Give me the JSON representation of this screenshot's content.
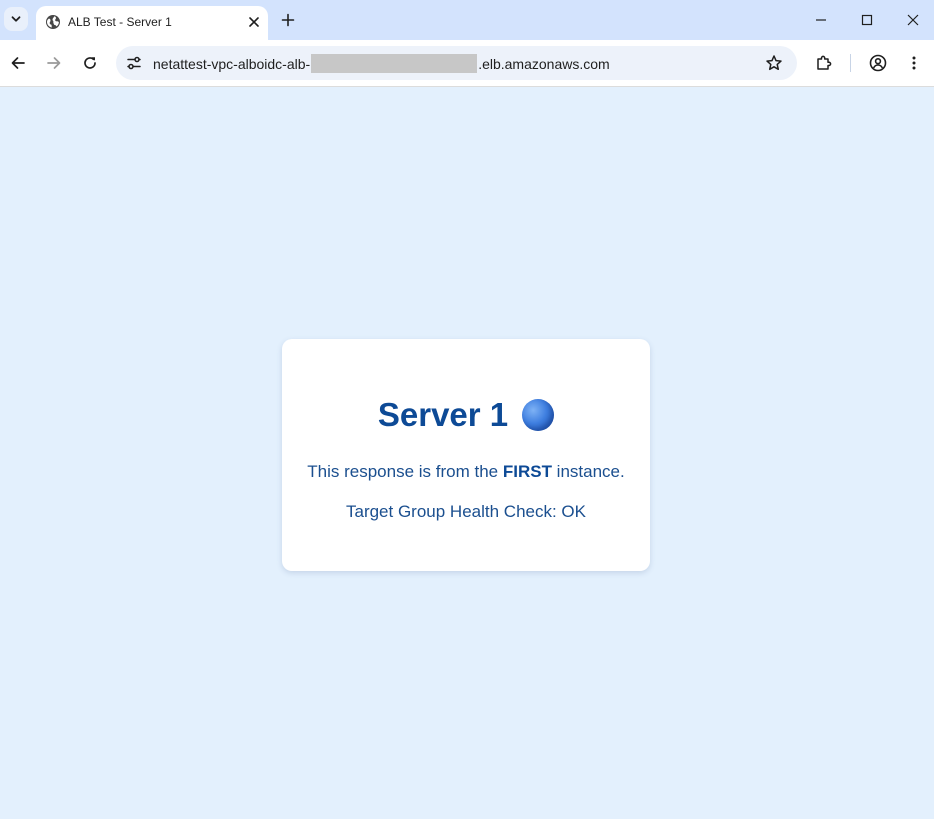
{
  "tab": {
    "title": "ALB Test - Server 1"
  },
  "omnibox": {
    "url_prefix": "netattest-vpc-alboidc-alb-",
    "url_suffix": ".elb.amazonaws.com"
  },
  "icons": {
    "tab_search": "chevron-down-icon",
    "favicon": "globe-icon",
    "close": "close-icon",
    "new_tab": "plus-icon",
    "back": "back-arrow-icon",
    "forward": "forward-arrow-icon",
    "reload": "reload-icon",
    "site_info": "tune-icon",
    "bookmark": "star-icon",
    "extensions": "puzzle-icon",
    "profile": "profile-icon",
    "menu": "kebab-menu-icon"
  },
  "page": {
    "heading": "Server 1",
    "line1_before": "This response is from the ",
    "line1_strong": "FIRST",
    "line1_after": " instance.",
    "line2": "Target Group Health Check: OK"
  },
  "colors": {
    "page_background": "#e3f0fd",
    "heading": "#0d4a96",
    "text": "#1b4f8f",
    "tabstrip": "#d3e3fd"
  }
}
